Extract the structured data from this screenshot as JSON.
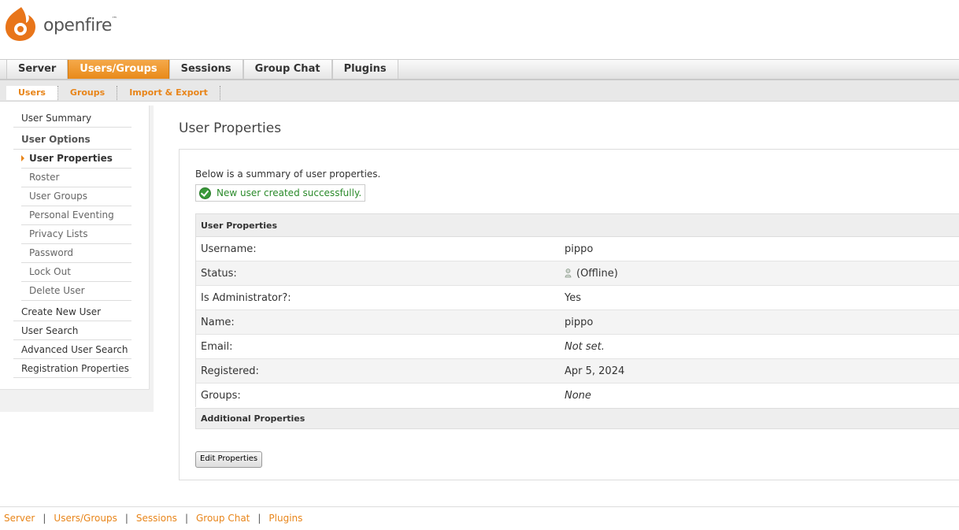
{
  "logo": {
    "text": "openfire",
    "tm": "™"
  },
  "main_tabs": [
    {
      "label": "Server"
    },
    {
      "label": "Users/Groups"
    },
    {
      "label": "Sessions"
    },
    {
      "label": "Group Chat"
    },
    {
      "label": "Plugins"
    }
  ],
  "sub_tabs": [
    {
      "label": "Users"
    },
    {
      "label": "Groups"
    },
    {
      "label": "Import & Export"
    }
  ],
  "sidebar": {
    "user_summary": "User Summary",
    "user_options": "User Options",
    "user_properties": "User Properties",
    "roster": "Roster",
    "user_groups": "User Groups",
    "personal_eventing": "Personal Eventing",
    "privacy_lists": "Privacy Lists",
    "password": "Password",
    "lock_out": "Lock Out",
    "delete_user": "Delete User",
    "create_new_user": "Create New User",
    "user_search": "User Search",
    "advanced_user_search": "Advanced User Search",
    "registration_properties": "Registration Properties"
  },
  "content": {
    "title": "User Properties",
    "summary": "Below is a summary of user properties.",
    "success": "New user created successfully.",
    "table_header": "User Properties",
    "rows": {
      "username_label": "Username:",
      "username_value": "pippo",
      "status_label": "Status:",
      "status_value": "(Offline)",
      "admin_label": "Is Administrator?:",
      "admin_value": "Yes",
      "name_label": "Name:",
      "name_value": "pippo",
      "email_label": "Email:",
      "email_value": "Not set.",
      "registered_label": "Registered:",
      "registered_value": "Apr 5, 2024",
      "groups_label": "Groups:",
      "groups_value": "None"
    },
    "additional_header": "Additional Properties",
    "edit_button": "Edit Properties"
  },
  "footer": {
    "links": [
      "Server",
      "Users/Groups",
      "Sessions",
      "Group Chat",
      "Plugins"
    ],
    "sep": "|"
  },
  "colors": {
    "accent": "#e8851a",
    "success": "#2a8a2a"
  }
}
